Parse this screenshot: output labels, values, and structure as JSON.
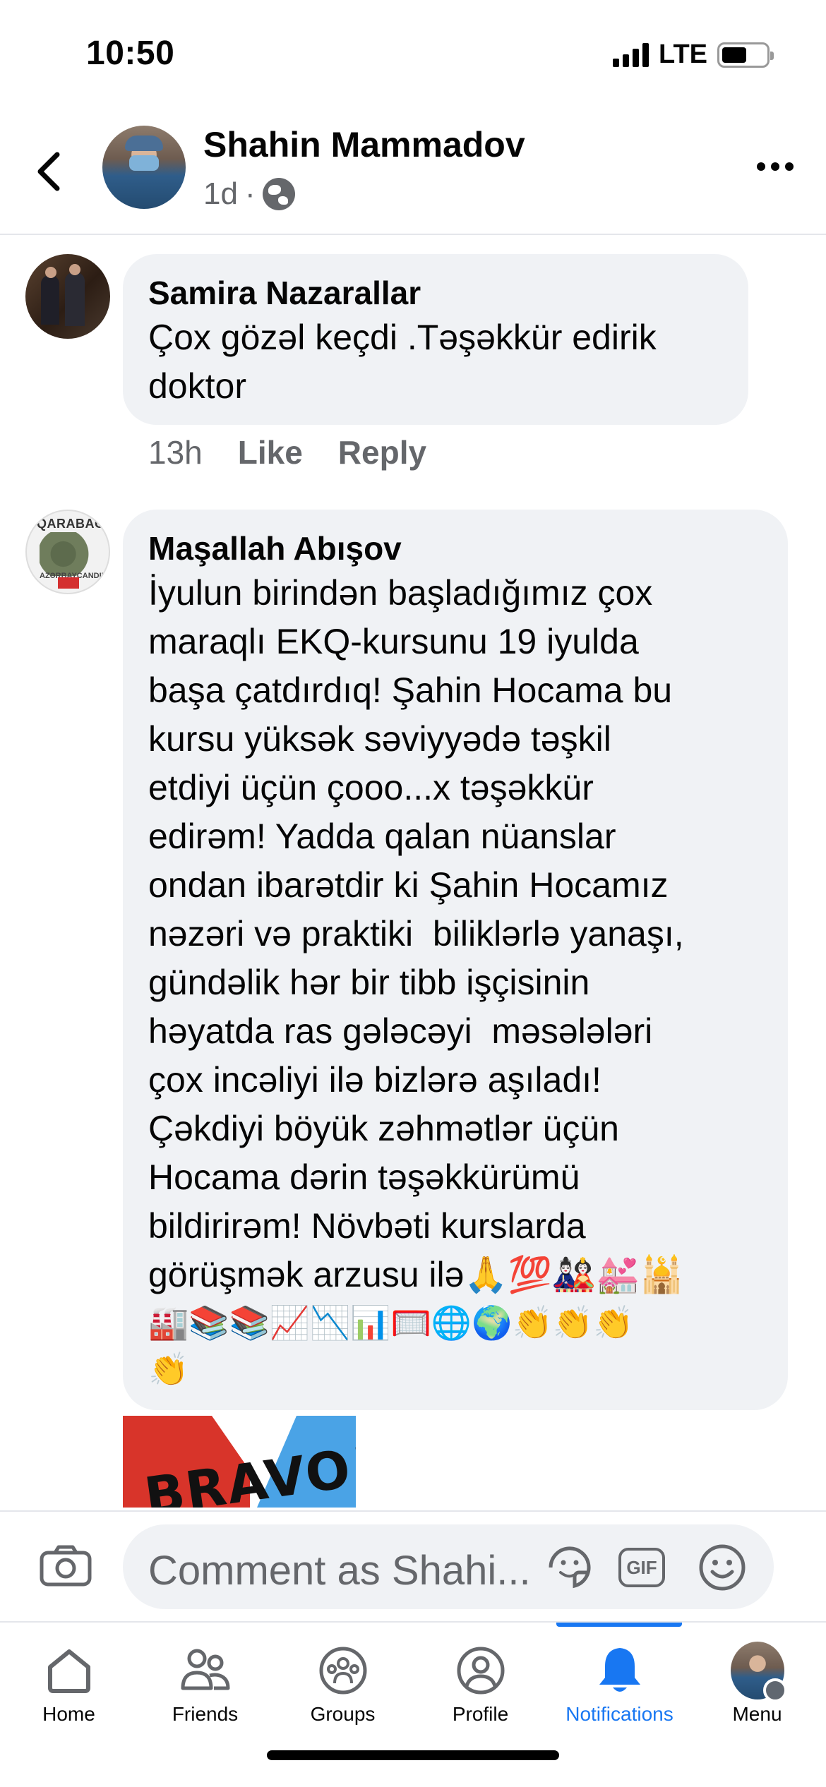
{
  "status_bar": {
    "time": "10:50",
    "network": "LTE"
  },
  "header": {
    "author": "Shahin Mammadov",
    "time_ago": "1d",
    "separator": "·"
  },
  "comments": [
    {
      "author": "Samira Nazarallar",
      "text": "Çox gözəl keçdi .Təşəkkür edirik\ndoktor",
      "time": "13h",
      "like_label": "Like",
      "reply_label": "Reply"
    },
    {
      "author": "Maşallah Abışov",
      "avatar_text_top": "QARABAĞ",
      "avatar_text_bottom": "AZƏRBAYCANDIR!",
      "text": "İyulun birindən başladığımız çox\nmaraqlı EKQ-kursunu 19 iyulda\nbaşa çatdırdıq! Şahin Hocama bu\nkursu yüksək səviyyədə təşkil\netdiyi üçün çooo...x təşəkkür\nedirəm! Yadda qalan nüanslar\nondan ibarətdir ki Şahin Hocamız\nnəzəri və praktiki  biliklərlə yanaşı,\ngündəlik hər bir tibb işçisinin\nhəyatda ras gələcəyi  məsələləri\nçox incəliyi ilə bizlərə aşıladı!\nÇəkdiyi böyük zəhmətlər üçün\nHocama dərin təşəkkürümü\nbildirirəm! Növbəti kurslarda\ngörüşmək arzusu ilə🙏💯🎎💒🕌",
      "emoji_line": "🏭📚📚📈📉📊🥅🌐🌍👏👏👏",
      "emoji_line2": "👏",
      "sticker_text": "BRAVO!"
    }
  ],
  "composer": {
    "placeholder": "Comment as Shahi...",
    "gif_label": "GIF"
  },
  "tabs": [
    {
      "label": "Home",
      "icon": "home-icon"
    },
    {
      "label": "Friends",
      "icon": "friends-icon"
    },
    {
      "label": "Groups",
      "icon": "groups-icon"
    },
    {
      "label": "Profile",
      "icon": "profile-icon"
    },
    {
      "label": "Notifications",
      "icon": "bell-icon",
      "active": true
    },
    {
      "label": "Menu",
      "icon": "menu-avatar"
    }
  ],
  "colors": {
    "accent": "#1877f2",
    "bubble": "#f0f2f5",
    "secondary_text": "#65676b"
  }
}
